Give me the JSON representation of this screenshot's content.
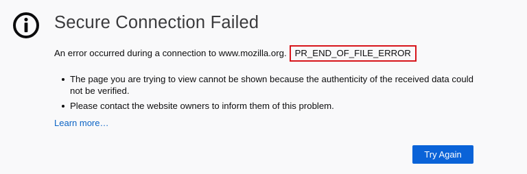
{
  "page": {
    "title": "Secure Connection Failed",
    "error_intro": "An error occurred during a connection to www.mozilla.org.",
    "error_code": "PR_END_OF_FILE_ERROR",
    "bullets": [
      "The page you are trying to view cannot be shown because the authenticity of the received data could not be verified.",
      "Please contact the website owners to inform them of this problem."
    ],
    "learn_more": "Learn more…",
    "try_again": "Try Again"
  },
  "icons": {
    "info": "info-circle-icon"
  },
  "colors": {
    "background": "#f9f9fa",
    "link": "#0a63c5",
    "button": "#0a63d8",
    "error_highlight": "#d7141a"
  }
}
